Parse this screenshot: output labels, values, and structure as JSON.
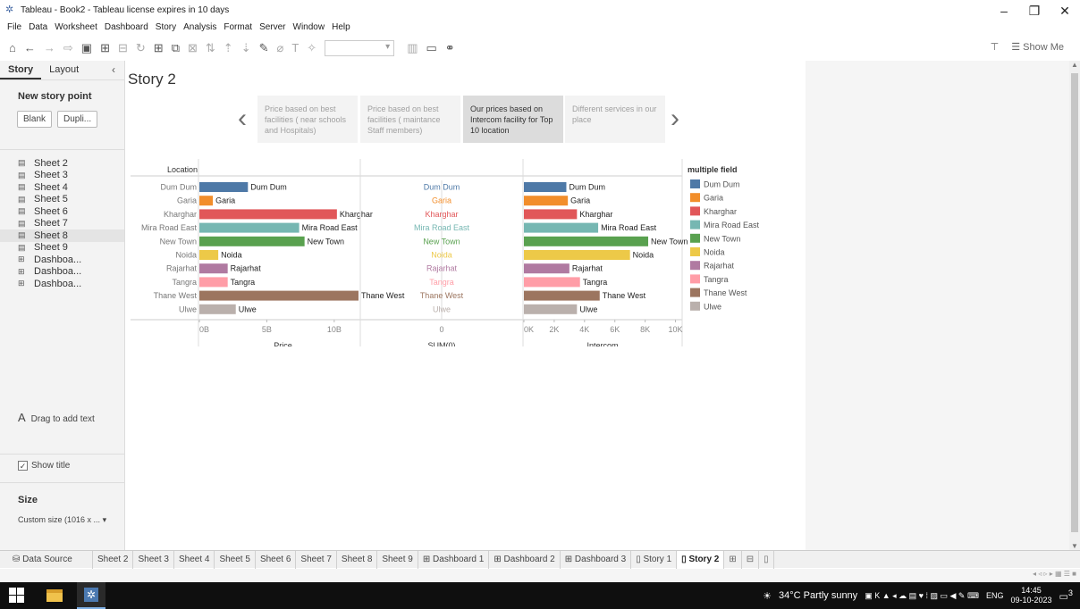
{
  "window": {
    "title": "Tableau - Book2 - Tableau license expires in 10 days",
    "controls": [
      "–",
      "❐",
      "✕"
    ]
  },
  "menu": [
    "File",
    "Data",
    "Worksheet",
    "Dashboard",
    "Story",
    "Analysis",
    "Format",
    "Server",
    "Window",
    "Help"
  ],
  "toolbar": {
    "show_me": "Show Me"
  },
  "sidebar": {
    "tabs": [
      "Story",
      "Layout"
    ],
    "new_story_point": "New story point",
    "blank_button": "Blank",
    "duplicate_button": "Dupli...",
    "sheets": [
      {
        "label": "Sheet 2",
        "icon": "worksheet-icon"
      },
      {
        "label": "Sheet 3",
        "icon": "worksheet-icon"
      },
      {
        "label": "Sheet 4",
        "icon": "worksheet-icon"
      },
      {
        "label": "Sheet 5",
        "icon": "worksheet-icon"
      },
      {
        "label": "Sheet 6",
        "icon": "worksheet-icon"
      },
      {
        "label": "Sheet 7",
        "icon": "worksheet-icon"
      },
      {
        "label": "Sheet 8",
        "icon": "worksheet-icon"
      },
      {
        "label": "Sheet 9",
        "icon": "worksheet-icon"
      },
      {
        "label": "Dashboa...",
        "icon": "dashboard-icon"
      },
      {
        "label": "Dashboa...",
        "icon": "dashboard-icon"
      },
      {
        "label": "Dashboa...",
        "icon": "dashboard-icon"
      }
    ],
    "drag_text": "Drag to add text",
    "show_title": "Show title",
    "size_heading": "Size",
    "size_value": "Custom size (1016 x ..."
  },
  "story": {
    "title": "Story 2",
    "points": [
      "Price based on best facilities ( near schools and Hospitals)",
      "Price based on best facilities ( maintance Staff members)",
      "Our prices based on Intercom facility for Top 10 location",
      "Different services in our place"
    ],
    "active_point": 2
  },
  "chart_data": {
    "type": "bar",
    "row_header": "Location",
    "categories": [
      "Dum Dum",
      "Garia",
      "Kharghar",
      "Mira Road East",
      "New Town",
      "Noida",
      "Rajarhat",
      "Tangra",
      "Thane West",
      "Ulwe"
    ],
    "colors": [
      "#4e79a7",
      "#f28e2b",
      "#e15759",
      "#76b7b2",
      "#59a14f",
      "#edc948",
      "#b07aa1",
      "#ff9da7",
      "#9c755f",
      "#bab0ac"
    ],
    "panels": [
      {
        "xlabel": "Price",
        "ticks": [
          "0B",
          "5B",
          "10B"
        ],
        "xlim": [
          0,
          12
        ],
        "values": [
          3.6,
          1.0,
          10.2,
          7.4,
          7.8,
          1.4,
          2.1,
          2.1,
          11.8,
          2.7
        ]
      },
      {
        "xlabel": "SUM(0)",
        "ticks": [
          "0"
        ],
        "xlim": [
          -1,
          1
        ],
        "values": [
          0,
          0,
          0,
          0,
          0,
          0,
          0,
          0,
          0,
          0
        ]
      },
      {
        "xlabel": "Intercom",
        "ticks": [
          "0K",
          "2K",
          "4K",
          "6K",
          "8K",
          "10K"
        ],
        "xlim": [
          0,
          10.5
        ],
        "values": [
          2.8,
          2.9,
          3.5,
          4.9,
          8.2,
          7.0,
          3.0,
          3.7,
          5.0,
          3.5
        ]
      }
    ],
    "legend": {
      "title": "multiple field",
      "position": "right"
    }
  },
  "bottom_tabs": [
    {
      "label": "Data Source",
      "icon": "database-icon"
    },
    {
      "label": "Sheet 2"
    },
    {
      "label": "Sheet 3"
    },
    {
      "label": "Sheet 4"
    },
    {
      "label": "Sheet 5"
    },
    {
      "label": "Sheet 6"
    },
    {
      "label": "Sheet 7"
    },
    {
      "label": "Sheet 8"
    },
    {
      "label": "Sheet 9"
    },
    {
      "label": "Dashboard 1",
      "icon": "dashboard-icon"
    },
    {
      "label": "Dashboard 2",
      "icon": "dashboard-icon"
    },
    {
      "label": "Dashboard 3",
      "icon": "dashboard-icon"
    },
    {
      "label": "Story 1",
      "icon": "story-icon"
    },
    {
      "label": "Story 2",
      "icon": "story-icon",
      "active": true
    }
  ],
  "taskbar": {
    "weather": "34°C  Partly sunny",
    "language": "ENG",
    "time": "14:45",
    "date": "09-10-2023",
    "notifications": "3"
  }
}
